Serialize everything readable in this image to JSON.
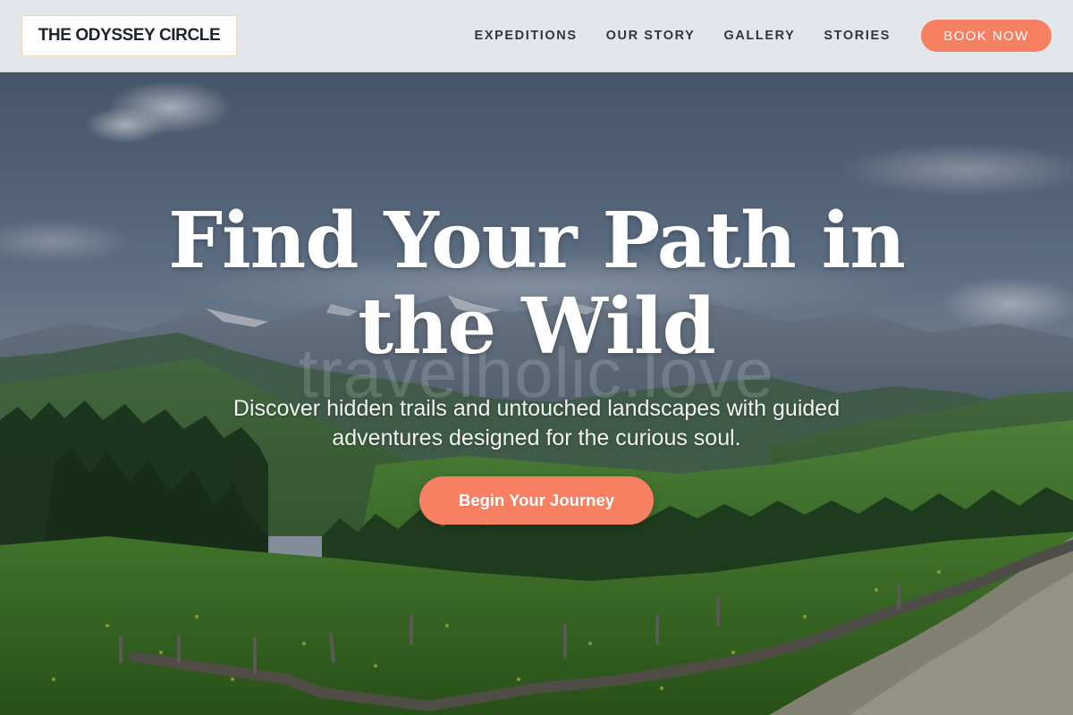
{
  "header": {
    "logo_text": "THE ODYSSEY CIRCLE",
    "nav_items": [
      {
        "label": "EXPEDITIONS"
      },
      {
        "label": "OUR STORY"
      },
      {
        "label": "GALLERY"
      },
      {
        "label": "STORIES"
      }
    ],
    "book_button_label": "BOOK NOW"
  },
  "hero": {
    "title": "Find Your Path in the Wild",
    "subtitle": "Discover hidden trails and untouched landscapes with guided adventures designed for the curious soul.",
    "cta_label": "Begin Your Journey",
    "watermark": "travelholic.love"
  },
  "colors": {
    "accent": "#f77f62",
    "header_bg": "#e8ebf0",
    "nav_text": "#2f3640",
    "logo_text": "#1e232b",
    "hero_text": "#ffffff"
  }
}
